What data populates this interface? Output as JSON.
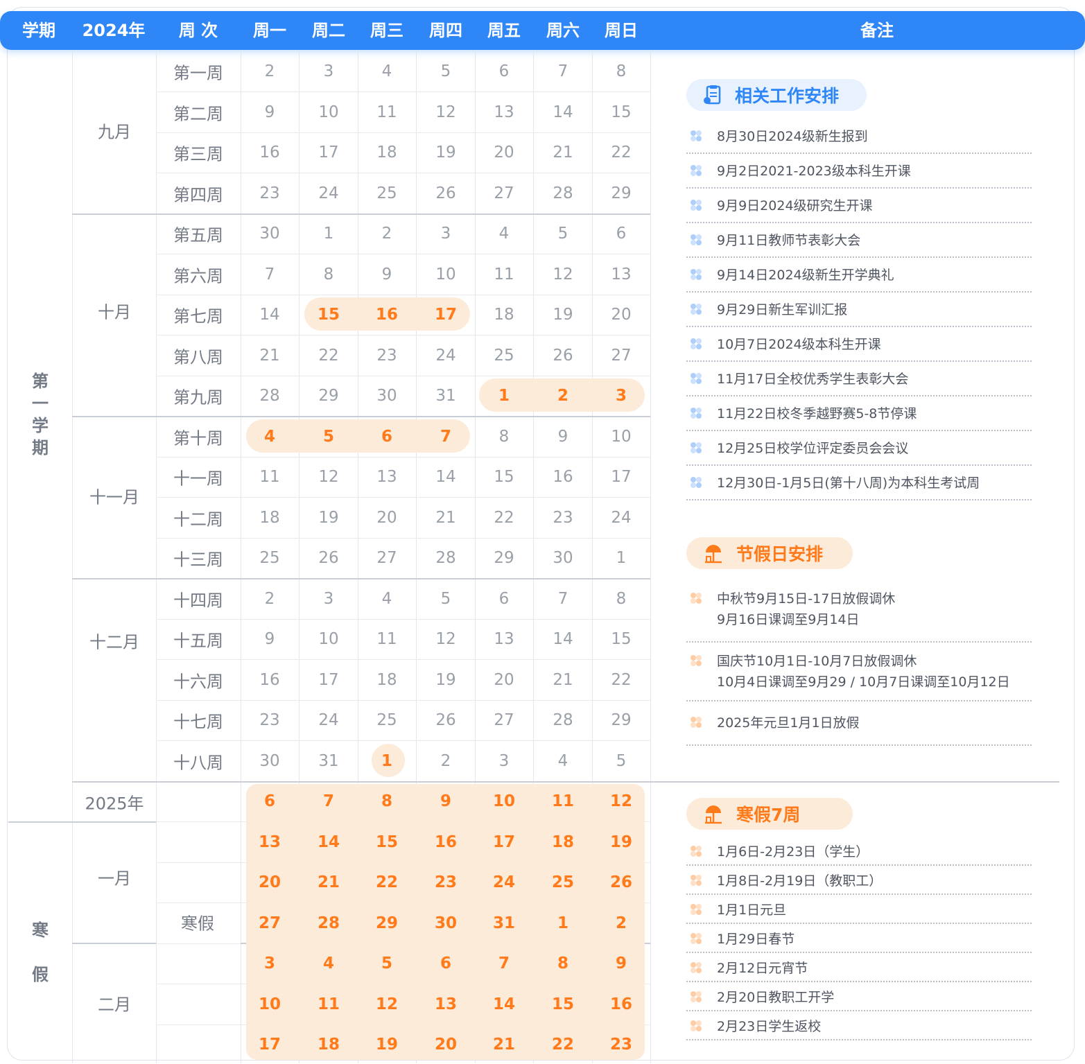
{
  "header": {
    "labels": [
      "学期",
      "2024年",
      "周 次",
      "周一",
      "周二",
      "周三",
      "周四",
      "周五",
      "周六",
      "周日",
      "备注"
    ]
  },
  "terms": {
    "first": [
      "第",
      "一",
      "学",
      "期"
    ],
    "winter": [
      "寒",
      "假"
    ]
  },
  "months": {
    "sep": "九月",
    "oct": "十月",
    "nov": "十一月",
    "dec": "十二月",
    "year2025": "2025年",
    "jan": "一月",
    "feb": "二月"
  },
  "winter_label": "寒假",
  "weeks": [
    {
      "name": "第一周",
      "days": [
        "2",
        "3",
        "4",
        "5",
        "6",
        "7",
        "8"
      ],
      "hot": []
    },
    {
      "name": "第二周",
      "days": [
        "9",
        "10",
        "11",
        "12",
        "13",
        "14",
        "15"
      ],
      "hot": []
    },
    {
      "name": "第三周",
      "days": [
        "16",
        "17",
        "18",
        "19",
        "20",
        "21",
        "22"
      ],
      "hot": []
    },
    {
      "name": "第四周",
      "days": [
        "23",
        "24",
        "25",
        "26",
        "27",
        "28",
        "29"
      ],
      "hot": []
    },
    {
      "name": "第五周",
      "days": [
        "30",
        "1",
        "2",
        "3",
        "4",
        "5",
        "6"
      ],
      "hot": []
    },
    {
      "name": "第六周",
      "days": [
        "7",
        "8",
        "9",
        "10",
        "11",
        "12",
        "13"
      ],
      "hot": []
    },
    {
      "name": "第七周",
      "days": [
        "14",
        "15",
        "16",
        "17",
        "18",
        "19",
        "20"
      ],
      "hot": [
        1,
        2,
        3
      ]
    },
    {
      "name": "第八周",
      "days": [
        "21",
        "22",
        "23",
        "24",
        "25",
        "26",
        "27"
      ],
      "hot": []
    },
    {
      "name": "第九周",
      "days": [
        "28",
        "29",
        "30",
        "31",
        "1",
        "2",
        "3"
      ],
      "hot": [
        4,
        5,
        6
      ]
    },
    {
      "name": "第十周",
      "days": [
        "4",
        "5",
        "6",
        "7",
        "8",
        "9",
        "10"
      ],
      "hot": [
        0,
        1,
        2,
        3
      ]
    },
    {
      "name": "十一周",
      "days": [
        "11",
        "12",
        "13",
        "14",
        "15",
        "16",
        "17"
      ],
      "hot": []
    },
    {
      "name": "十二周",
      "days": [
        "18",
        "19",
        "20",
        "21",
        "22",
        "23",
        "24"
      ],
      "hot": []
    },
    {
      "name": "十三周",
      "days": [
        "25",
        "26",
        "27",
        "28",
        "29",
        "30",
        "1"
      ],
      "hot": []
    },
    {
      "name": "十四周",
      "days": [
        "2",
        "3",
        "4",
        "5",
        "6",
        "7",
        "8"
      ],
      "hot": []
    },
    {
      "name": "十五周",
      "days": [
        "9",
        "10",
        "11",
        "12",
        "13",
        "14",
        "15"
      ],
      "hot": []
    },
    {
      "name": "十六周",
      "days": [
        "16",
        "17",
        "18",
        "19",
        "20",
        "21",
        "22"
      ],
      "hot": []
    },
    {
      "name": "十七周",
      "days": [
        "23",
        "24",
        "25",
        "26",
        "27",
        "28",
        "29"
      ],
      "hot": []
    },
    {
      "name": "十八周",
      "days": [
        "30",
        "31",
        "1",
        "2",
        "3",
        "4",
        "5"
      ],
      "hot": [
        2
      ]
    },
    {
      "name": "",
      "days": [
        "6",
        "7",
        "8",
        "9",
        "10",
        "11",
        "12"
      ],
      "hot": [
        0,
        1,
        2,
        3,
        4,
        5,
        6
      ]
    },
    {
      "name": "",
      "days": [
        "13",
        "14",
        "15",
        "16",
        "17",
        "18",
        "19"
      ],
      "hot": [
        0,
        1,
        2,
        3,
        4,
        5,
        6
      ]
    },
    {
      "name": "",
      "days": [
        "20",
        "21",
        "22",
        "23",
        "24",
        "25",
        "26"
      ],
      "hot": [
        0,
        1,
        2,
        3,
        4,
        5,
        6
      ]
    },
    {
      "name": "",
      "days": [
        "27",
        "28",
        "29",
        "30",
        "31",
        "1",
        "2"
      ],
      "hot": [
        0,
        1,
        2,
        3,
        4,
        5,
        6
      ]
    },
    {
      "name": "",
      "days": [
        "3",
        "4",
        "5",
        "6",
        "7",
        "8",
        "9"
      ],
      "hot": [
        0,
        1,
        2,
        3,
        4,
        5,
        6
      ]
    },
    {
      "name": "",
      "days": [
        "10",
        "11",
        "12",
        "13",
        "14",
        "15",
        "16"
      ],
      "hot": [
        0,
        1,
        2,
        3,
        4,
        5,
        6
      ]
    },
    {
      "name": "",
      "days": [
        "17",
        "18",
        "19",
        "20",
        "21",
        "22",
        "23"
      ],
      "hot": [
        0,
        1,
        2,
        3,
        4,
        5,
        6
      ]
    }
  ],
  "sections": {
    "work": {
      "title": "相关工作安排",
      "items": [
        "8月30日2024级新生报到",
        "9月2日2021-2023级本科生开课",
        "9月9日2024级研究生开课",
        "9月11日教师节表彰大会",
        "9月14日2024级新生开学典礼",
        "9月29日新生军训汇报",
        "10月7日2024级本科生开课",
        "11月17日全校优秀学生表彰大会",
        "11月22日校冬季越野赛5-8节停课",
        "12月25日校学位评定委员会会议",
        "12月30日-1月5日(第十八周)为本科生考试周"
      ]
    },
    "holiday": {
      "title": "节假日安排",
      "items": [
        {
          "line1": "中秋节9月15日-17日放假调休",
          "line2": "9月16日课调至9月14日"
        },
        {
          "line1": "国庆节10月1日-10月7日放假调休",
          "line2": "10月4日课调至9月29 / 10月7日课调至10月12日"
        },
        {
          "line1": "2025年元旦1月1日放假",
          "line2": ""
        }
      ]
    },
    "winter": {
      "title": "寒假7周",
      "items": [
        "1月6日-2月23日（学生）",
        "1月8日-2月19日（教职工）",
        "1月1日元旦",
        "1月29日春节",
        "2月12日元宵节",
        "2月20日教职工开学",
        "2月23日学生返校"
      ]
    }
  },
  "colors": {
    "header": "#2f86f6",
    "accent": "#ff7a1a",
    "highlight": "#fdebd9"
  }
}
